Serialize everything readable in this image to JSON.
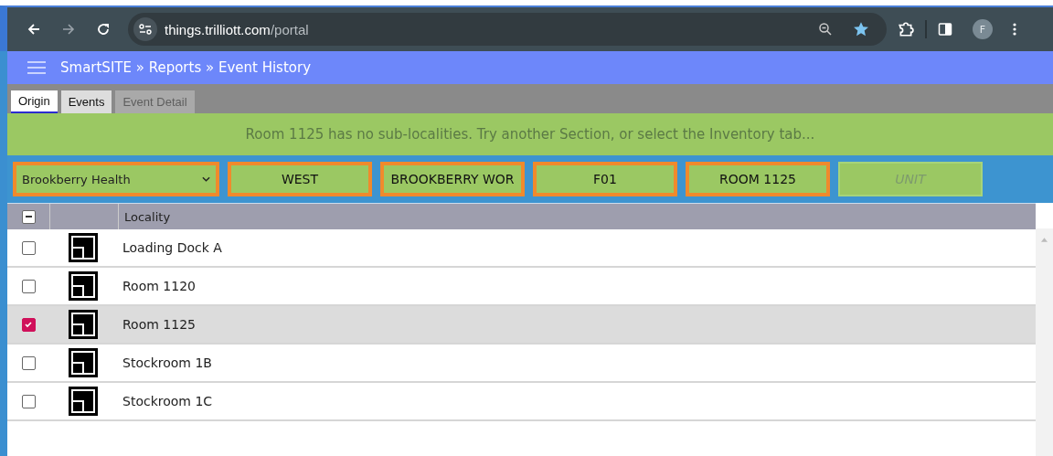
{
  "browser": {
    "url_host": "things.trilliott.com",
    "url_path": "/portal",
    "avatar": "F"
  },
  "header": {
    "breadcrumb": "SmartSITE » Reports » Event History"
  },
  "tabs": [
    {
      "label": "Origin",
      "selected": true,
      "disabled": false
    },
    {
      "label": "Events",
      "selected": false,
      "disabled": false
    },
    {
      "label": "Event Detail",
      "selected": false,
      "disabled": true
    }
  ],
  "banner": "Room 1125 has no sub-localities. Try another Section, or select the Inventory tab...",
  "filters": [
    {
      "kind": "select",
      "label": "Brookberry Health",
      "disabled": false
    },
    {
      "kind": "button",
      "label": "WEST",
      "disabled": false
    },
    {
      "kind": "button",
      "label": "BROOKBERRY WOR",
      "disabled": false
    },
    {
      "kind": "button",
      "label": "F01",
      "disabled": false
    },
    {
      "kind": "button",
      "label": "ROOM 1125",
      "disabled": false
    },
    {
      "kind": "button",
      "label": "UNIT",
      "disabled": true
    }
  ],
  "table": {
    "header_checkbox": {
      "partial": true
    },
    "columns": [
      "Locality"
    ],
    "rows": [
      {
        "locality": "Loading Dock A",
        "checked": false,
        "selected": false
      },
      {
        "locality": "Room 1120",
        "checked": false,
        "selected": false
      },
      {
        "locality": "Room 1125",
        "checked": true,
        "selected": true
      },
      {
        "locality": "Stockroom 1B",
        "checked": false,
        "selected": false
      },
      {
        "locality": "Stockroom 1C",
        "checked": false,
        "selected": false
      }
    ]
  }
}
